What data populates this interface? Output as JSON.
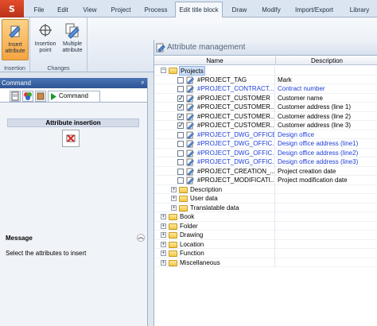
{
  "tabs": [
    "File",
    "Edit",
    "View",
    "Project",
    "Process",
    "Edit title block",
    "Draw",
    "Modify",
    "Import/Export",
    "Library"
  ],
  "active_tab_index": 5,
  "ribbon": {
    "insertion_group": {
      "title": "Insertion",
      "insert_attribute": "Insert attribute"
    },
    "changes_group": {
      "title": "Changes",
      "insertion_point": "Insertion point",
      "multiple_attribute": "Multiple attribute"
    }
  },
  "command_panel": {
    "header": "Command",
    "tab_label": "Command",
    "attribute_insertion_title": "Attribute insertion",
    "message_title": "Message",
    "message_text": "Select the attributes to insert"
  },
  "attr_panel": {
    "title": "Attribute management",
    "col_name": "Name",
    "col_description": "Description",
    "rows": [
      {
        "type": "folder",
        "level": 0,
        "toggle": "−",
        "label": "Projects",
        "desc": "",
        "selected": true
      },
      {
        "type": "attr",
        "level": 1,
        "checked": false,
        "label": "#PROJECT_TAG",
        "desc": "Mark",
        "blue": false
      },
      {
        "type": "attr",
        "level": 1,
        "checked": false,
        "label": "#PROJECT_CONTRACT...",
        "desc": "Contract number",
        "blue": true
      },
      {
        "type": "attr",
        "level": 1,
        "checked": true,
        "label": "#PROJECT_CUSTOMER",
        "desc": "Customer name",
        "blue": false
      },
      {
        "type": "attr",
        "level": 1,
        "checked": true,
        "label": "#PROJECT_CUSTOMER...",
        "desc": "Customer address (line 1)",
        "blue": false
      },
      {
        "type": "attr",
        "level": 1,
        "checked": true,
        "label": "#PROJECT_CUSTOMER...",
        "desc": "Customer address (line 2)",
        "blue": false
      },
      {
        "type": "attr",
        "level": 1,
        "checked": true,
        "label": "#PROJECT_CUSTOMER...",
        "desc": "Customer address (line 3)",
        "blue": false
      },
      {
        "type": "attr",
        "level": 1,
        "checked": false,
        "label": "#PROJECT_DWG_OFFICE",
        "desc": "Design office",
        "blue": true
      },
      {
        "type": "attr",
        "level": 1,
        "checked": false,
        "label": "#PROJECT_DWG_OFFIC...",
        "desc": "Design office address (line1)",
        "blue": true
      },
      {
        "type": "attr",
        "level": 1,
        "checked": false,
        "label": "#PROJECT_DWG_OFFIC...",
        "desc": "Design office address (line2)",
        "blue": true
      },
      {
        "type": "attr",
        "level": 1,
        "checked": false,
        "label": "#PROJECT_DWG_OFFIC...",
        "desc": "Design office address (line3)",
        "blue": true
      },
      {
        "type": "attr",
        "level": 1,
        "checked": false,
        "label": "#PROJECT_CREATION_...",
        "desc": "Project creation date",
        "blue": false
      },
      {
        "type": "attr",
        "level": 1,
        "checked": false,
        "label": "#PROJECT_MODIFICATI...",
        "desc": "Project modification date",
        "blue": false
      },
      {
        "type": "folder",
        "level": 1,
        "toggle": "+",
        "label": "Description",
        "desc": ""
      },
      {
        "type": "folder",
        "level": 1,
        "toggle": "+",
        "label": "User data",
        "desc": ""
      },
      {
        "type": "folder",
        "level": 1,
        "toggle": "+",
        "label": "Translatable data",
        "desc": ""
      },
      {
        "type": "folder",
        "level": 0,
        "toggle": "+",
        "label": "Book",
        "desc": ""
      },
      {
        "type": "folder",
        "level": 0,
        "toggle": "+",
        "label": "Folder",
        "desc": ""
      },
      {
        "type": "folder",
        "level": 0,
        "toggle": "+",
        "label": "Drawing",
        "desc": ""
      },
      {
        "type": "folder",
        "level": 0,
        "toggle": "+",
        "label": "Location",
        "desc": ""
      },
      {
        "type": "folder",
        "level": 0,
        "toggle": "+",
        "label": "Function",
        "desc": ""
      },
      {
        "type": "folder",
        "level": 0,
        "toggle": "+",
        "label": "Miscellaneous",
        "desc": ""
      }
    ]
  },
  "colors": {
    "accent_blue": "#1d3fd6",
    "selected_button": "#f5a441",
    "header_blue": "#2f5594"
  }
}
